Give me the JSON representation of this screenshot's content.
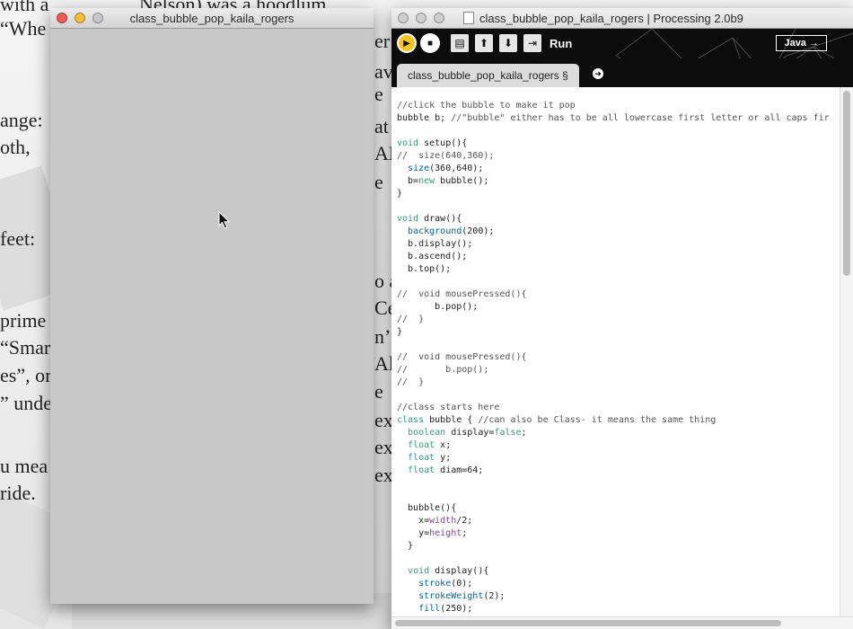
{
  "background_doc": {
    "lines": [
      "with a",
      "“Whe",
      "Nelson) was a hoodlum.",
      "ange:",
      "oth,",
      "feet:",
      "prime",
      "“Smar",
      "es”, or",
      "” unde",
      "u mea",
      "ride.",
      "av",
      "er",
      "at",
      "AL",
      "o a",
      "Ce",
      "n’r",
      "Ali",
      "e",
      "ex",
      "ex",
      "ex",
      "e",
      "e"
    ]
  },
  "sketch_window": {
    "title": "class_bubble_pop_kaila_rogers",
    "canvas_color": "#c8c8c8"
  },
  "ide_window": {
    "title": "class_bubble_pop_kaila_rogers | Processing 2.0b9",
    "toolbar": {
      "run_label": "Run",
      "mode_label": "Java",
      "buttons": [
        "run-icon",
        "stop-icon",
        "new-icon",
        "open-icon",
        "save-icon",
        "export-icon"
      ]
    },
    "tab": {
      "label": "class_bubble_pop_kaila_rogers §"
    },
    "code_lines": [
      "//click the bubble to make it pop",
      "bubble b; //\"bubble\" either has to be all lowercase first letter or all caps fir",
      "",
      "void setup(){",
      "//  size(640,360);",
      "  size(360,640);",
      "  b=new bubble();",
      "}",
      "",
      "void draw(){",
      "  background(200);",
      "  b.display();",
      "  b.ascend();",
      "  b.top();",
      "",
      "//  void mousePressed(){",
      "       b.pop();",
      "//  }",
      "}",
      "",
      "//  void mousePressed(){",
      "//       b.pop();",
      "//  }",
      "",
      "//class starts here",
      "class bubble { //can also be Class- it means the same thing",
      "  boolean display=false;",
      "  float x;",
      "  float y;",
      "  float diam=64;",
      "",
      "",
      "  bubble(){",
      "    x=width/2;",
      "    y=height;",
      "  }",
      "",
      "  void display(){",
      "    stroke(0);",
      "    strokeWeight(2);",
      "    fill(250);"
    ]
  }
}
